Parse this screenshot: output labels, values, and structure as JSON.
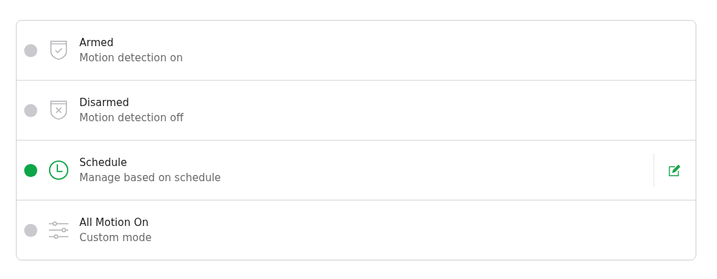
{
  "modes": [
    {
      "kind": "armed",
      "title": "Armed",
      "subtitle": "Motion detection on",
      "selected": false
    },
    {
      "kind": "disarmed",
      "title": "Disarmed",
      "subtitle": "Motion detection off",
      "selected": false
    },
    {
      "kind": "schedule",
      "title": "Schedule",
      "subtitle": "Manage based on schedule",
      "selected": true
    },
    {
      "kind": "custom",
      "title": "All Motion On",
      "subtitle": "Custom mode",
      "selected": false
    }
  ]
}
